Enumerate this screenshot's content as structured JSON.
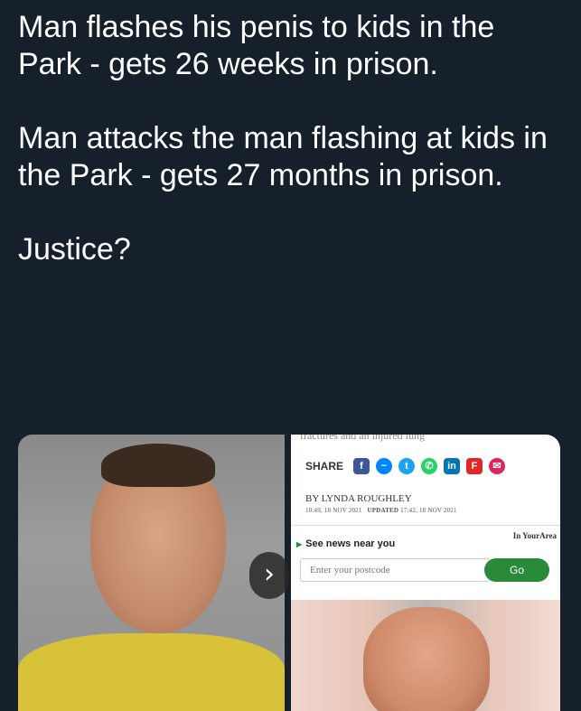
{
  "tweet": {
    "paragraph_1": "Man flashes his penis to kids in the Park - gets 26 weeks in prison.",
    "paragraph_2": "Man attacks the man flashing at kids in the Park - gets 27 months in prison.",
    "paragraph_3": "Justice?"
  },
  "carousel": {
    "next_glyph": "›"
  },
  "article": {
    "cut_text": "fractures and an injured lung",
    "share_label": "SHARE",
    "share_icons": [
      {
        "name": "facebook-icon",
        "glyph": "f",
        "color": "#3b5998"
      },
      {
        "name": "messenger-icon",
        "glyph": "~",
        "color": "#0084ff"
      },
      {
        "name": "twitter-icon",
        "glyph": "t",
        "color": "#1da1f2"
      },
      {
        "name": "whatsapp-icon",
        "glyph": "✆",
        "color": "#25d366"
      },
      {
        "name": "linkedin-icon",
        "glyph": "in",
        "color": "#0077b5"
      },
      {
        "name": "flipboard-icon",
        "glyph": "F",
        "color": "#e12828"
      },
      {
        "name": "email-icon",
        "glyph": "✉",
        "color": "#e0245e"
      }
    ],
    "byline": "BY LYNDA ROUGHLEY",
    "published": "10:49, 18 NOV 2021",
    "updated_label": "UPDATED",
    "updated": "17:42, 18 NOV 2021",
    "near_label": "See news near you",
    "in_your_area": "In YourArea",
    "postcode_placeholder": "Enter your postcode",
    "go_label": "Go"
  }
}
